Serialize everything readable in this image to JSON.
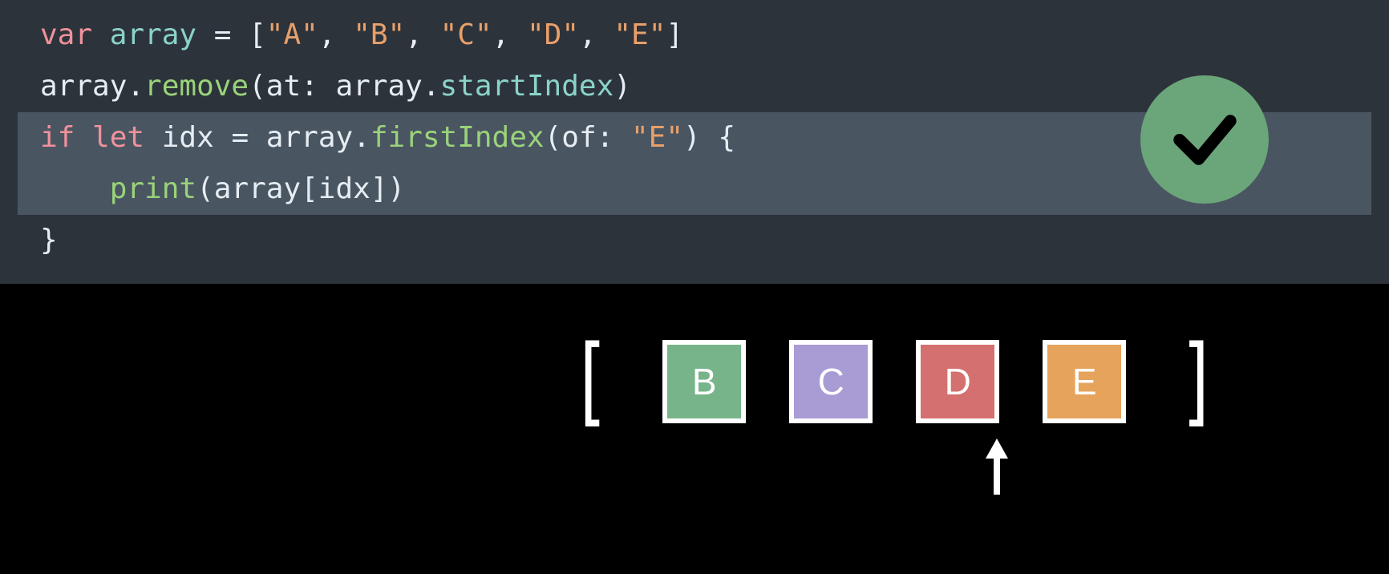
{
  "code": {
    "line1": {
      "var": "var",
      "name": "array",
      "eq": " = [",
      "s1": "\"A\"",
      "c1": ", ",
      "s2": "\"B\"",
      "c2": ", ",
      "s3": "\"C\"",
      "c3": ", ",
      "s4": "\"D\"",
      "c4": ", ",
      "s5": "\"E\"",
      "close": "]"
    },
    "line2": {
      "pre": "array.",
      "remove": "remove",
      "mid": "(at: array.",
      "startIndex": "startIndex",
      "end": ")"
    },
    "line3": {
      "if": "if",
      "sp1": " ",
      "let": "let",
      "mid1": " idx = array.",
      "firstIndex": "firstIndex",
      "mid2": "(of: ",
      "strE": "\"E\"",
      "end": ") {"
    },
    "line4": {
      "indent": "    ",
      "print": "print",
      "body": "(array[idx])"
    },
    "line5": {
      "brace": "}"
    }
  },
  "diagram": {
    "bracketOpen": "[",
    "bracketClose": "]",
    "boxes": [
      {
        "label": "B",
        "color": "#78b489"
      },
      {
        "label": "C",
        "color": "#a99bd4"
      },
      {
        "label": "D",
        "color": "#d4706f"
      },
      {
        "label": "E",
        "color": "#e6a35c"
      }
    ],
    "pointerIndex": 3
  },
  "status": {
    "result": "valid"
  }
}
